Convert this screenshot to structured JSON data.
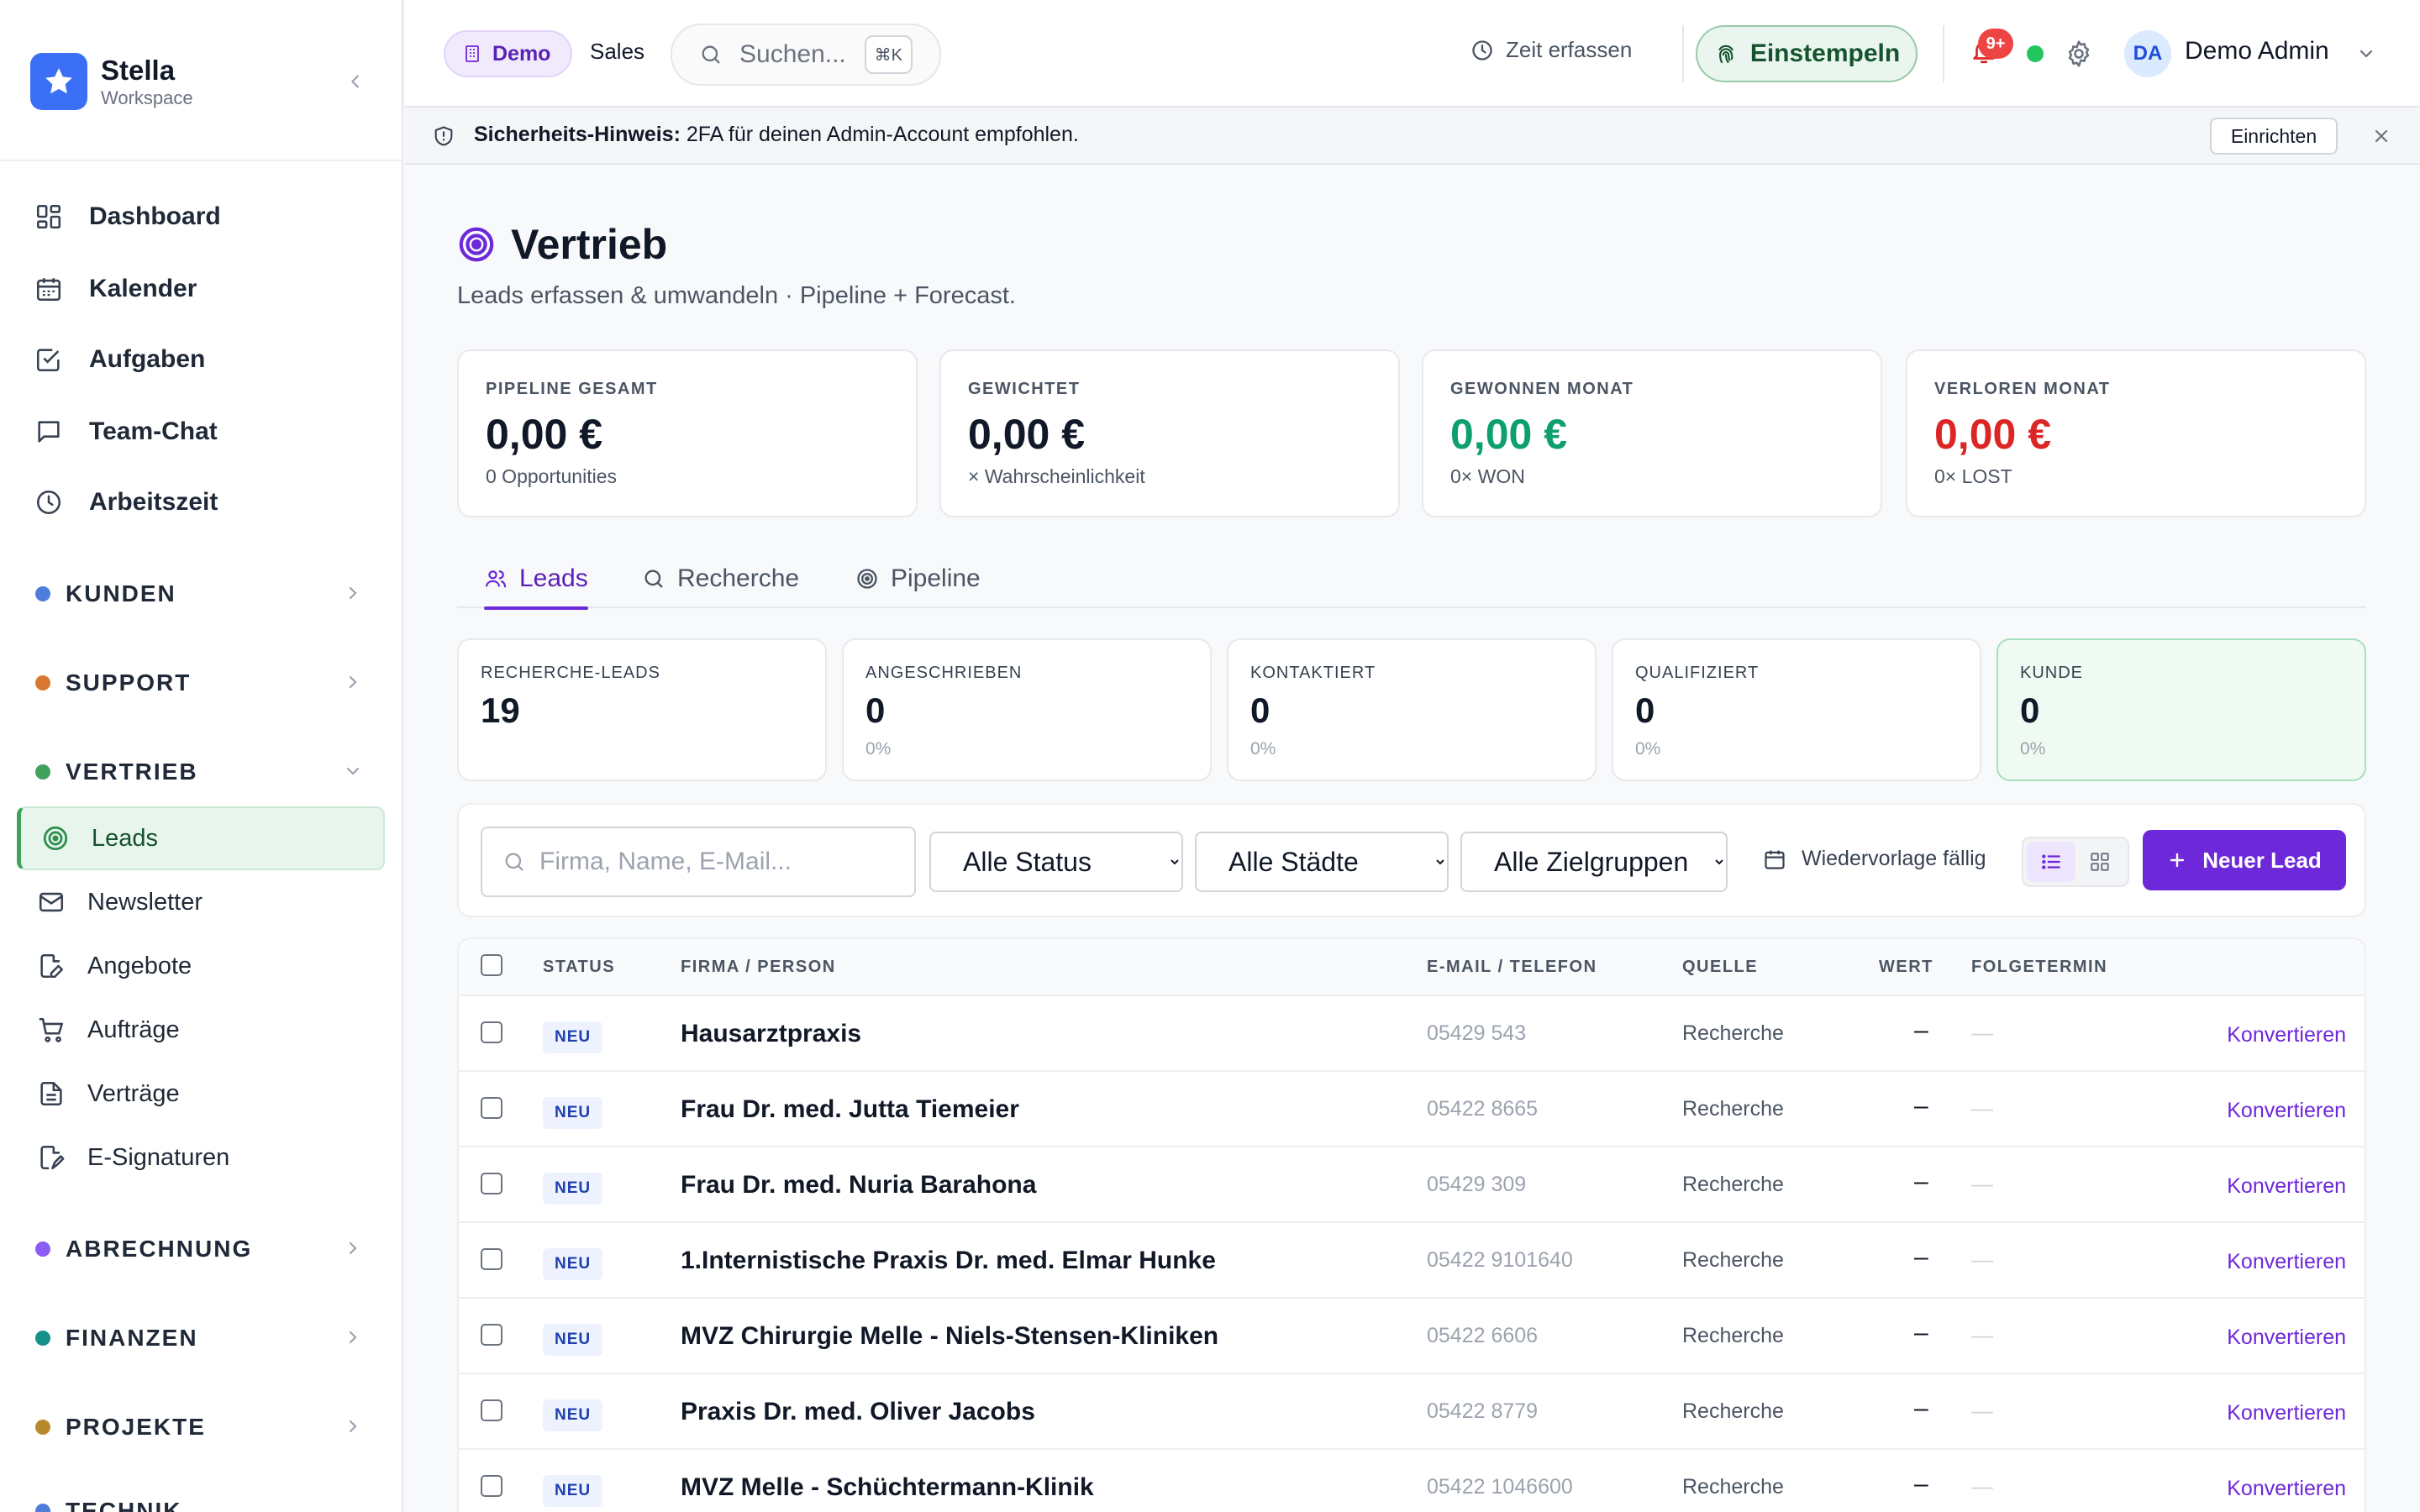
{
  "brand": {
    "name": "Stella",
    "subtitle": "Workspace"
  },
  "nav": {
    "main": [
      {
        "label": "Dashboard",
        "icon": "grid-icon"
      },
      {
        "label": "Kalender",
        "icon": "calendar-icon"
      },
      {
        "label": "Aufgaben",
        "icon": "check-square-icon"
      },
      {
        "label": "Team-Chat",
        "icon": "chat-icon"
      },
      {
        "label": "Arbeitszeit",
        "icon": "clock-icon"
      }
    ],
    "sections": {
      "kunden": {
        "label": "KUNDEN",
        "color": "#4f7ddb"
      },
      "support": {
        "label": "SUPPORT",
        "color": "#d9792f"
      },
      "vertrieb": {
        "label": "VERTRIEB",
        "color": "#3fa35b"
      },
      "abrechnung": {
        "label": "ABRECHNUNG",
        "color": "#8b5cf6"
      },
      "finanzen": {
        "label": "FINANZEN",
        "color": "#14918a"
      },
      "projekte": {
        "label": "PROJEKTE",
        "color": "#b8892b"
      },
      "technik": {
        "label": "TECHNIK"
      }
    },
    "vertrieb_items": [
      {
        "label": "Leads",
        "icon": "target-icon",
        "active": true
      },
      {
        "label": "Newsletter",
        "icon": "mail-icon"
      },
      {
        "label": "Angebote",
        "icon": "edit-doc-icon"
      },
      {
        "label": "Aufträge",
        "icon": "cart-icon"
      },
      {
        "label": "Verträge",
        "icon": "document-icon"
      },
      {
        "label": "E-Signaturen",
        "icon": "signature-icon"
      }
    ]
  },
  "header": {
    "demo_label": "Demo",
    "sales_label": "Sales",
    "search_placeholder": "Suchen...",
    "search_shortcut": "⌘K",
    "time_label": "Zeit erfassen",
    "clockin_label": "Einstempeln",
    "notification_count": "9+",
    "user_initials": "DA",
    "user_name": "Demo Admin"
  },
  "banner": {
    "prefix": "Sicherheits-Hinweis:",
    "text": " 2FA für deinen Admin-Account empfohlen.",
    "action": "Einrichten"
  },
  "page": {
    "title": "Vertrieb",
    "subtitle": "Leads erfassen & umwandeln · Pipeline + Forecast."
  },
  "kpis": [
    {
      "label": "PIPELINE GESAMT",
      "value": "0,00 €",
      "sub": "0 Opportunities",
      "color": "#111827"
    },
    {
      "label": "GEWICHTET",
      "value": "0,00 €",
      "sub": "× Wahrscheinlichkeit",
      "color": "#111827"
    },
    {
      "label": "GEWONNEN MONAT",
      "value": "0,00 €",
      "sub": "0× WON",
      "color": "#0e9f6e"
    },
    {
      "label": "VERLOREN MONAT",
      "value": "0,00 €",
      "sub": "0× LOST",
      "color": "#dc2626"
    }
  ],
  "tabs": [
    {
      "label": "Leads",
      "icon": "users-icon",
      "active": true
    },
    {
      "label": "Recherche",
      "icon": "search-icon"
    },
    {
      "label": "Pipeline",
      "icon": "target-icon"
    }
  ],
  "stats": [
    {
      "label": "RECHERCHE-LEADS",
      "value": "19",
      "pct": ""
    },
    {
      "label": "ANGESCHRIEBEN",
      "value": "0",
      "pct": "0%"
    },
    {
      "label": "KONTAKTIERT",
      "value": "0",
      "pct": "0%"
    },
    {
      "label": "QUALIFIZIERT",
      "value": "0",
      "pct": "0%"
    },
    {
      "label": "KUNDE",
      "value": "0",
      "pct": "0%"
    }
  ],
  "filters": {
    "search_placeholder": "Firma, Name, E-Mail...",
    "status": "Alle Status",
    "cities": "Alle Städte",
    "audiences": "Alle Zielgruppen",
    "followup_label": "Wiedervorlage fällig",
    "new_lead_label": "Neuer Lead"
  },
  "table": {
    "columns": {
      "status": "STATUS",
      "firm": "FIRMA / PERSON",
      "contact": "E-MAIL / TELEFON",
      "source": "QUELLE",
      "value": "WERT",
      "followup": "FOLGETERMIN"
    },
    "rows": [
      {
        "status": "NEU",
        "firm": "Hausarztpraxis",
        "phone": "05429 543",
        "source": "Recherche",
        "value": "–",
        "followup": "—",
        "action": "Konvertieren"
      },
      {
        "status": "NEU",
        "firm": "Frau Dr. med. Jutta Tiemeier",
        "phone": "05422 8665",
        "source": "Recherche",
        "value": "–",
        "followup": "—",
        "action": "Konvertieren"
      },
      {
        "status": "NEU",
        "firm": "Frau Dr. med. Nuria Barahona",
        "phone": "05429 309",
        "source": "Recherche",
        "value": "–",
        "followup": "—",
        "action": "Konvertieren"
      },
      {
        "status": "NEU",
        "firm": "1.Internistische Praxis Dr. med. Elmar Hunke",
        "phone": "05422 9101640",
        "source": "Recherche",
        "value": "–",
        "followup": "—",
        "action": "Konvertieren"
      },
      {
        "status": "NEU",
        "firm": "MVZ Chirurgie Melle - Niels-Stensen-Kliniken",
        "phone": "05422 6606",
        "source": "Recherche",
        "value": "–",
        "followup": "—",
        "action": "Konvertieren"
      },
      {
        "status": "NEU",
        "firm": "Praxis Dr. med. Oliver Jacobs",
        "phone": "05422 8779",
        "source": "Recherche",
        "value": "–",
        "followup": "—",
        "action": "Konvertieren"
      },
      {
        "status": "NEU",
        "firm": "MVZ Melle - Schüchtermann-Klinik",
        "phone": "05422 1046600",
        "source": "Recherche",
        "value": "–",
        "followup": "—",
        "action": "Konvertieren"
      }
    ]
  }
}
